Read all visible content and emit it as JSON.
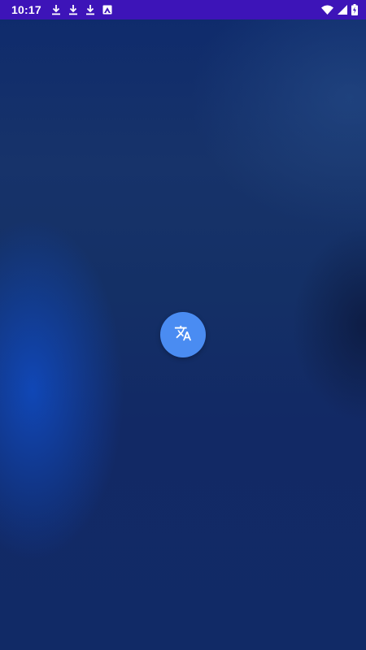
{
  "status_bar": {
    "time": "10:17",
    "notification_icons": [
      "download-icon",
      "download-icon",
      "download-icon",
      "photo-icon"
    ],
    "system_icons": [
      "wifi-icon",
      "cell-signal-icon",
      "battery-charging-icon"
    ],
    "background_color": "#3d14b8"
  },
  "fab": {
    "icon": "translate-icon",
    "color": "#4a8cf2"
  }
}
